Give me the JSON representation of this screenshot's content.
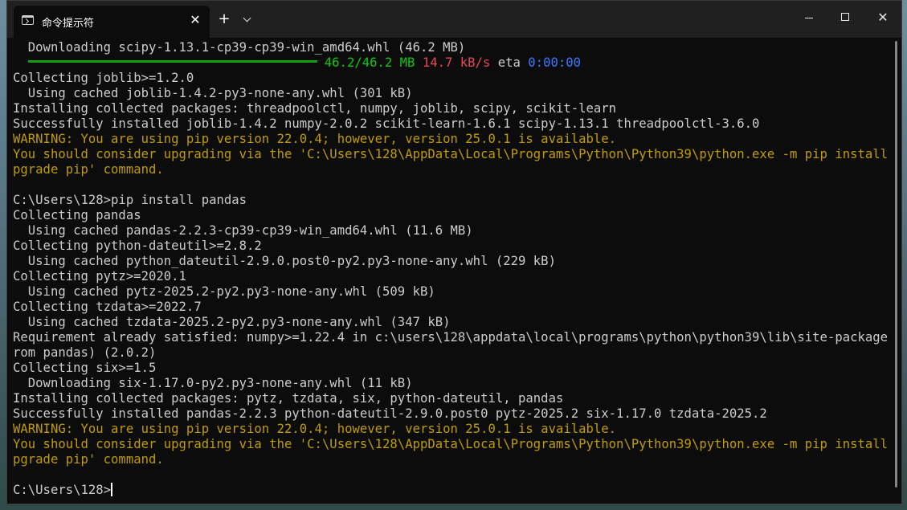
{
  "window": {
    "tab_title": "命令提示符",
    "tab_close": "✕",
    "new_tab": "+",
    "close": "✕"
  },
  "progress": {
    "fraction": 1.0,
    "size": "46.2/46.2 MB",
    "speed": "14.7 kB/s",
    "eta_label": "eta",
    "eta_value": "0:00:00"
  },
  "console": {
    "lines": [
      {
        "text": "  Downloading scipy-1.13.1-cp39-cp39-win_amd64.whl (46.2 MB)",
        "type": "normal"
      },
      {
        "text": "",
        "type": "progress"
      },
      {
        "text": "Collecting joblib>=1.2.0",
        "type": "normal"
      },
      {
        "text": "  Using cached joblib-1.4.2-py3-none-any.whl (301 kB)",
        "type": "normal"
      },
      {
        "text": "Installing collected packages: threadpoolctl, numpy, joblib, scipy, scikit-learn",
        "type": "normal"
      },
      {
        "text": "Successfully installed joblib-1.4.2 numpy-2.0.2 scikit-learn-1.6.1 scipy-1.13.1 threadpoolctl-3.6.0",
        "type": "normal"
      },
      {
        "text": "WARNING: You are using pip version 22.0.4; however, version 25.0.1 is available.",
        "type": "warn"
      },
      {
        "text": "You should consider upgrading via the 'C:\\Users\\128\\AppData\\Local\\Programs\\Python\\Python39\\python.exe -m pip install --u",
        "type": "warn"
      },
      {
        "text": "pgrade pip' command.",
        "type": "warn"
      },
      {
        "text": "",
        "type": "normal"
      },
      {
        "text": "C:\\Users\\128>pip install pandas",
        "type": "normal"
      },
      {
        "text": "Collecting pandas",
        "type": "normal"
      },
      {
        "text": "  Using cached pandas-2.2.3-cp39-cp39-win_amd64.whl (11.6 MB)",
        "type": "normal"
      },
      {
        "text": "Collecting python-dateutil>=2.8.2",
        "type": "normal"
      },
      {
        "text": "  Using cached python_dateutil-2.9.0.post0-py2.py3-none-any.whl (229 kB)",
        "type": "normal"
      },
      {
        "text": "Collecting pytz>=2020.1",
        "type": "normal"
      },
      {
        "text": "  Using cached pytz-2025.2-py2.py3-none-any.whl (509 kB)",
        "type": "normal"
      },
      {
        "text": "Collecting tzdata>=2022.7",
        "type": "normal"
      },
      {
        "text": "  Using cached tzdata-2025.2-py2.py3-none-any.whl (347 kB)",
        "type": "normal"
      },
      {
        "text": "Requirement already satisfied: numpy>=1.22.4 in c:\\users\\128\\appdata\\local\\programs\\python\\python39\\lib\\site-packages (f",
        "type": "normal"
      },
      {
        "text": "rom pandas) (2.0.2)",
        "type": "normal"
      },
      {
        "text": "Collecting six>=1.5",
        "type": "normal"
      },
      {
        "text": "  Downloading six-1.17.0-py2.py3-none-any.whl (11 kB)",
        "type": "normal"
      },
      {
        "text": "Installing collected packages: pytz, tzdata, six, python-dateutil, pandas",
        "type": "normal"
      },
      {
        "text": "Successfully installed pandas-2.2.3 python-dateutil-2.9.0.post0 pytz-2025.2 six-1.17.0 tzdata-2025.2",
        "type": "normal"
      },
      {
        "text": "WARNING: You are using pip version 22.0.4; however, version 25.0.1 is available.",
        "type": "warn"
      },
      {
        "text": "You should consider upgrading via the 'C:\\Users\\128\\AppData\\Local\\Programs\\Python\\Python39\\python.exe -m pip install --u",
        "type": "warn"
      },
      {
        "text": "pgrade pip' command.",
        "type": "warn"
      },
      {
        "text": "",
        "type": "normal"
      },
      {
        "text": "C:\\Users\\128>",
        "type": "prompt"
      }
    ]
  },
  "colors": {
    "background": "#0c0c0c",
    "text": "#cccccc",
    "warning": "#c19c00",
    "progress_green": "#16c60c",
    "speed_red": "#e74856",
    "eta_blue": "#3b78ff"
  }
}
